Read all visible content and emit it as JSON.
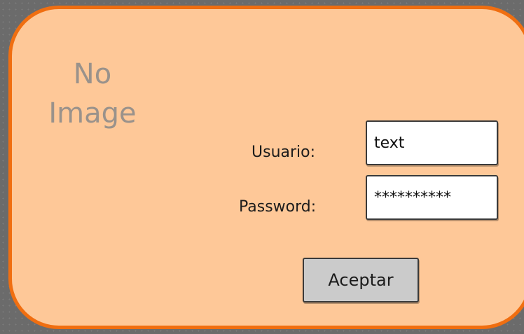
{
  "image_placeholder": {
    "line1": "No",
    "line2": "Image"
  },
  "login": {
    "username_label": "Usuario:",
    "username_value": "text",
    "password_label": "Password:",
    "password_value": "**********",
    "submit_label": "Aceptar"
  },
  "colors": {
    "background": "#6b6b6b",
    "panel_fill": "#fec898",
    "panel_border": "#f06e10",
    "placeholder_text": "#9a928b",
    "button_fill": "#cbcbcb"
  }
}
